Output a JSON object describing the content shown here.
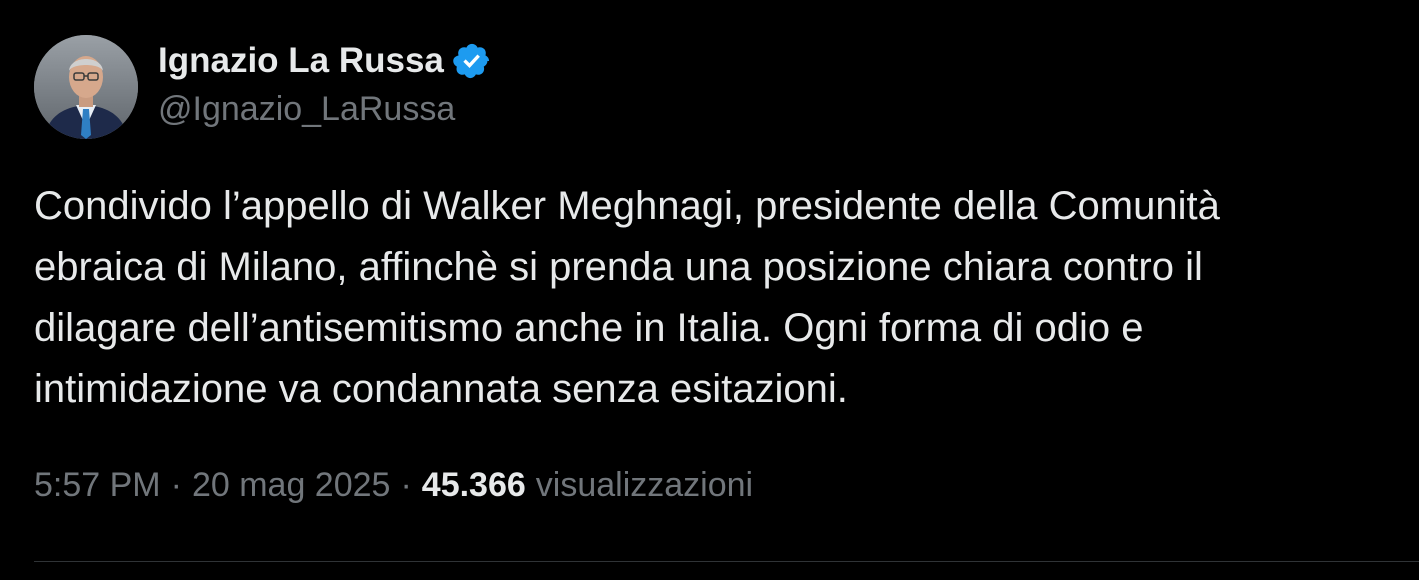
{
  "author": {
    "display_name": "Ignazio La Russa",
    "handle": "@Ignazio_LaRussa",
    "verified_icon": "verified-badge-icon",
    "avatar_icon": "profile-photo"
  },
  "tweet": {
    "lines": [
      "Condivido l’appello di Walker Meghnagi, presidente della Comunità",
      "ebraica di Milano, affinchè si prenda una posizione chiara contro il",
      "dilagare dell’antisemitismo anche in Italia. Ogni forma di odio e",
      "intimidazione va condannata senza esitazioni."
    ]
  },
  "meta": {
    "time": "5:57 PM",
    "separator": "·",
    "date": "20 mag 2025",
    "views_count": "45.366",
    "views_label": "visualizzazioni"
  },
  "colors": {
    "background": "#000000",
    "primary_text": "#e7e9ea",
    "secondary_text": "#71767b",
    "verified_blue": "#1d9bf0",
    "divider": "#2f3336"
  }
}
